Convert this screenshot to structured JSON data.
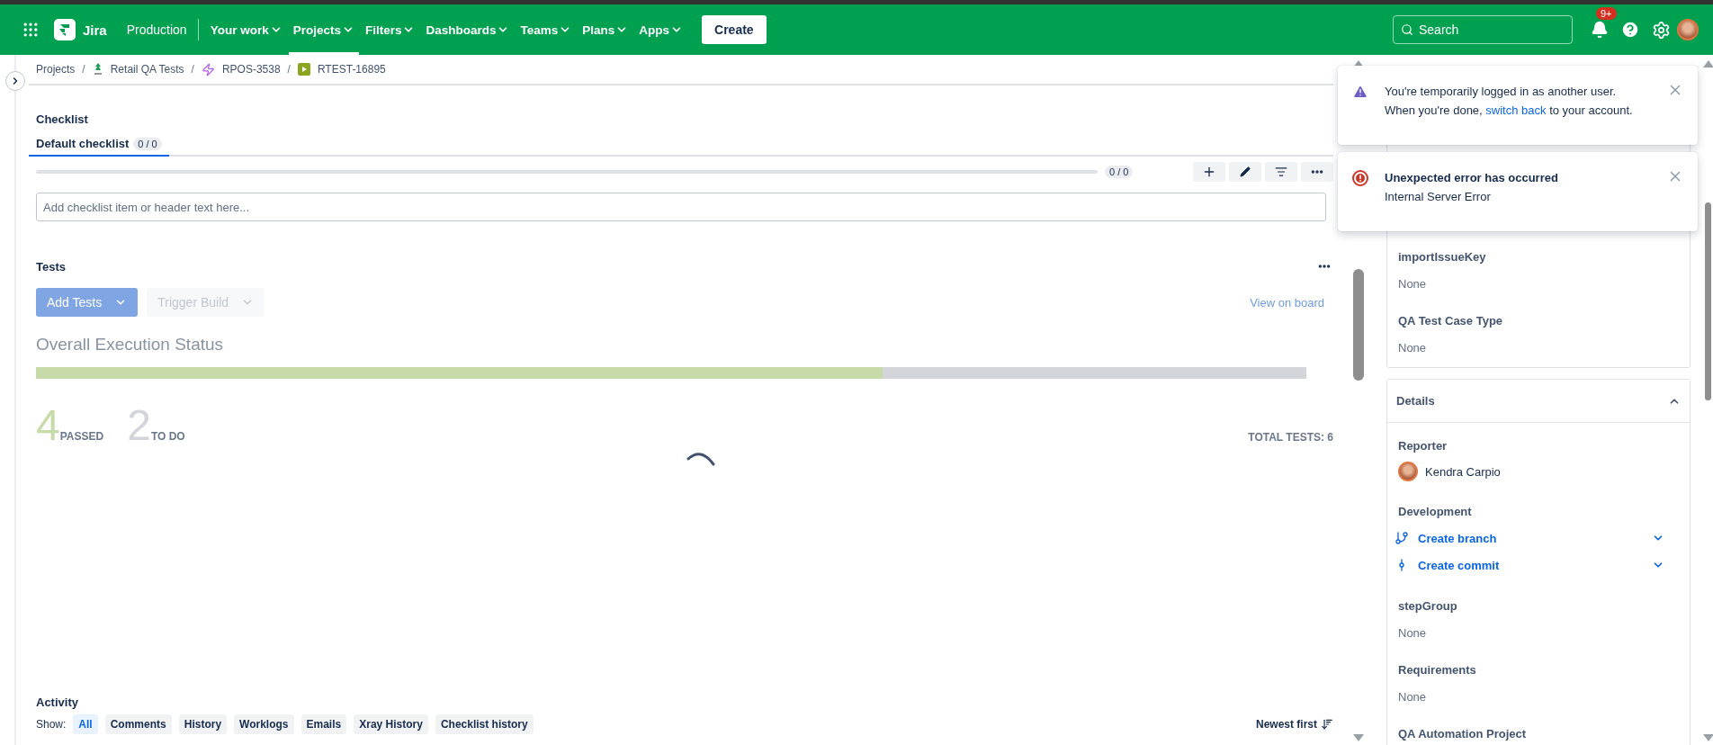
{
  "topbar": {
    "product": "Jira",
    "site": "Production",
    "nav": [
      {
        "label": "Your work",
        "selected": false
      },
      {
        "label": "Projects",
        "selected": true
      },
      {
        "label": "Filters",
        "selected": false
      },
      {
        "label": "Dashboards",
        "selected": false
      },
      {
        "label": "Teams",
        "selected": false
      },
      {
        "label": "Plans",
        "selected": false
      },
      {
        "label": "Apps",
        "selected": false
      }
    ],
    "create": "Create",
    "search": {
      "placeholder": "Search"
    },
    "notifications_badge": "9+"
  },
  "breadcrumbs": [
    {
      "label": "Projects",
      "kind": "text",
      "separator": "/"
    },
    {
      "label": "Retail QA Tests",
      "kind": "project",
      "separator": "/"
    },
    {
      "label": "RPOS-3538",
      "kind": "epic",
      "separator": "/"
    },
    {
      "label": "RTEST-16895",
      "kind": "test"
    }
  ],
  "checklist": {
    "title": "Checklist",
    "tabs": [
      {
        "label": "Default checklist",
        "count": "0 / 0",
        "selected": true
      }
    ],
    "progress": {
      "level": 0,
      "reading": "0 / 0"
    },
    "input": {
      "placeholder": "Add checklist item or header text here..."
    }
  },
  "tests": {
    "title": "Tests",
    "buttons": [
      {
        "label": "Add Tests",
        "disabled": false
      },
      {
        "label": "Trigger Build",
        "disabled": true
      }
    ],
    "link": "View on board",
    "status_title": "Overall Execution Status",
    "bar": {
      "level": 0.6667
    },
    "counts": [
      {
        "value": "4",
        "label": "PASSED",
        "color": "#c6dba8"
      },
      {
        "value": "2",
        "label": "TO DO",
        "color": "#d4d5da"
      }
    ],
    "total": "TOTAL TESTS: 6"
  },
  "activity": {
    "title": "Activity",
    "show_label": "Show:",
    "filters": [
      {
        "label": "All",
        "selected": true
      },
      {
        "label": "Comments",
        "selected": false
      },
      {
        "label": "History",
        "selected": false
      },
      {
        "label": "Worklogs",
        "selected": false
      },
      {
        "label": "Emails",
        "selected": false
      },
      {
        "label": "Xray History",
        "selected": false
      },
      {
        "label": "Checklist history",
        "selected": false
      }
    ],
    "sort": "Newest first"
  },
  "side_panel": {
    "fields": [
      {
        "label": "importIssueKey",
        "value": "None"
      },
      {
        "label": "QA Test Case Type",
        "value": "None"
      }
    ],
    "details": {
      "title": "Details",
      "expanded": true,
      "reporter_label": "Reporter",
      "reporter": "Kendra Carpio",
      "development_label": "Development",
      "development": [
        {
          "label": "Create branch",
          "kind": "branch"
        },
        {
          "label": "Create commit",
          "kind": "commit"
        }
      ],
      "fields": [
        {
          "label": "stepGroup",
          "value": "None"
        },
        {
          "label": "Requirements",
          "value": "None"
        },
        {
          "label": "QA Automation Project"
        }
      ]
    }
  },
  "toasts": [
    {
      "kind": "warning",
      "line1": "You're temporarily logged in as another user.",
      "before": "When you're done, ",
      "link": "switch back",
      "after": " to your account."
    },
    {
      "kind": "error",
      "title": "Unexpected error has occurred",
      "text": "Internal Server Error"
    }
  ]
}
